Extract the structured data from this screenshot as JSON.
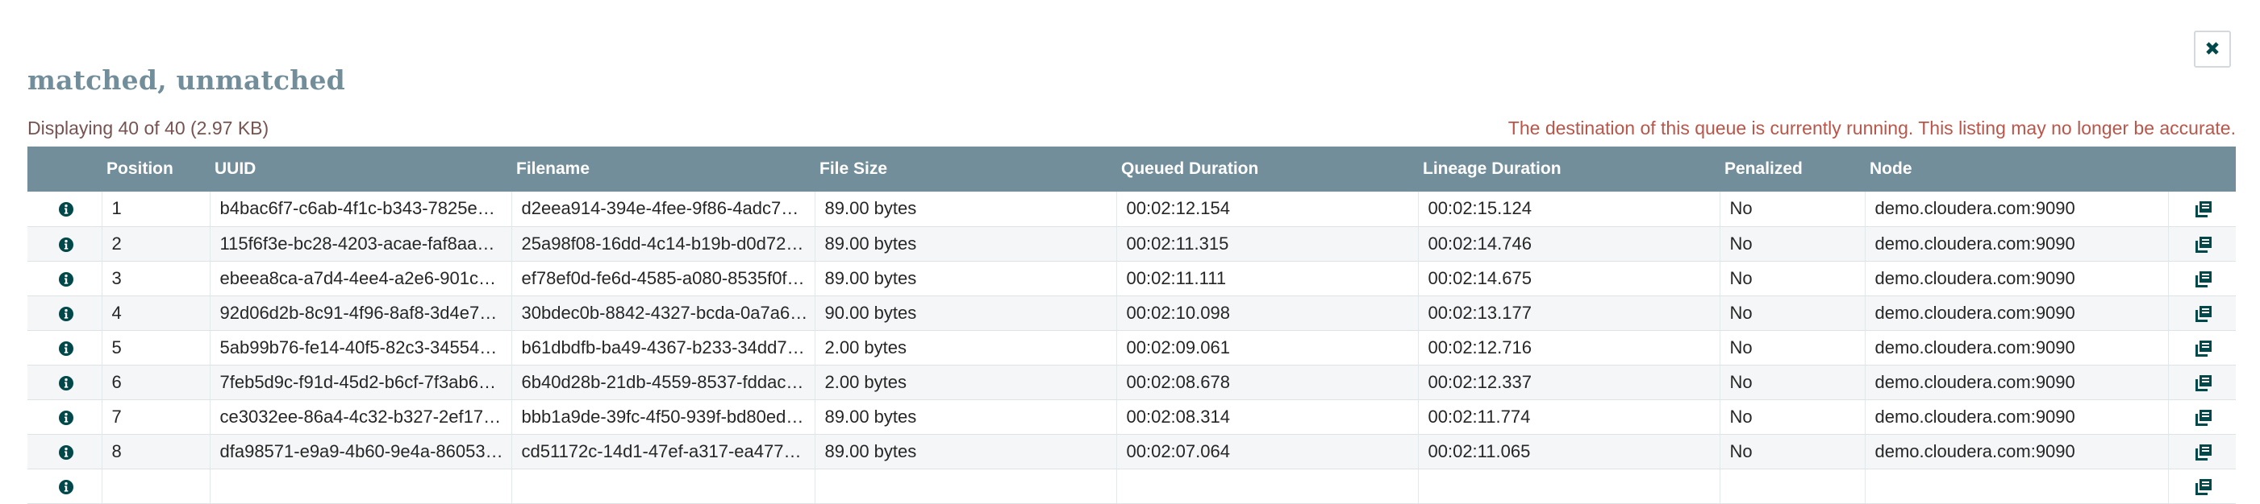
{
  "dialog": {
    "title": "matched, unmatched",
    "displaying": "Displaying 40 of 40 (2.97 KB)",
    "warning": "The destination of this queue is currently running. This listing may no longer be accurate."
  },
  "colors": {
    "header_bg": "#728e9b",
    "title": "#728e9b",
    "warning": "#ba554a",
    "displaying": "#775351",
    "icon": "#004849"
  },
  "icons": {
    "close": "close-icon",
    "row_info": "info-icon",
    "row_action": "provenance-icon"
  },
  "table": {
    "headers": [
      "",
      "Position",
      "UUID",
      "Filename",
      "File Size",
      "Queued Duration",
      "Lineage Duration",
      "Penalized",
      "Node",
      ""
    ],
    "rows": [
      {
        "position": "1",
        "uuid": "b4bac6f7-c6ab-4f1c-b343-7825e5…",
        "filename": "d2eea914-394e-4fee-9f86-4adc760…",
        "size": "89.00 bytes",
        "queued": "00:02:12.154",
        "lineage": "00:02:15.124",
        "penalized": "No",
        "node": "demo.cloudera.com:9090"
      },
      {
        "position": "2",
        "uuid": "115f6f3e-bc28-4203-acae-faf8aae…",
        "filename": "25a98f08-16dd-4c14-b19b-d0d727…",
        "size": "89.00 bytes",
        "queued": "00:02:11.315",
        "lineage": "00:02:14.746",
        "penalized": "No",
        "node": "demo.cloudera.com:9090"
      },
      {
        "position": "3",
        "uuid": "ebeea8ca-a7d4-4ee4-a2e6-901c48…",
        "filename": "ef78ef0d-fe6d-4585-a080-8535f0f…",
        "size": "89.00 bytes",
        "queued": "00:02:11.111",
        "lineage": "00:02:14.675",
        "penalized": "No",
        "node": "demo.cloudera.com:9090"
      },
      {
        "position": "4",
        "uuid": "92d06d2b-8c91-4f96-8af8-3d4e7c…",
        "filename": "30bdec0b-8842-4327-bcda-0a7a66…",
        "size": "90.00 bytes",
        "queued": "00:02:10.098",
        "lineage": "00:02:13.177",
        "penalized": "No",
        "node": "demo.cloudera.com:9090"
      },
      {
        "position": "5",
        "uuid": "5ab99b76-fe14-40f5-82c3-345549…",
        "filename": "b61dbdfb-ba49-4367-b233-34dd77…",
        "size": "2.00 bytes",
        "queued": "00:02:09.061",
        "lineage": "00:02:12.716",
        "penalized": "No",
        "node": "demo.cloudera.com:9090"
      },
      {
        "position": "6",
        "uuid": "7feb5d9c-f91d-45d2-b6cf-7f3ab6e…",
        "filename": "6b40d28b-21db-4559-8537-fddac0…",
        "size": "2.00 bytes",
        "queued": "00:02:08.678",
        "lineage": "00:02:12.337",
        "penalized": "No",
        "node": "demo.cloudera.com:9090"
      },
      {
        "position": "7",
        "uuid": "ce3032ee-86a4-4c32-b327-2ef17c…",
        "filename": "bbb1a9de-39fc-4f50-939f-bd80eda…",
        "size": "89.00 bytes",
        "queued": "00:02:08.314",
        "lineage": "00:02:11.774",
        "penalized": "No",
        "node": "demo.cloudera.com:9090"
      },
      {
        "position": "8",
        "uuid": "dfa98571-e9a9-4b60-9e4a-860534…",
        "filename": "cd51172c-14d1-47ef-a317-ea4773…",
        "size": "89.00 bytes",
        "queued": "00:02:07.064",
        "lineage": "00:02:11.065",
        "penalized": "No",
        "node": "demo.cloudera.com:9090"
      },
      {
        "position": "",
        "uuid": "",
        "filename": "",
        "size": "",
        "queued": "",
        "lineage": "",
        "penalized": "",
        "node": ""
      }
    ]
  }
}
